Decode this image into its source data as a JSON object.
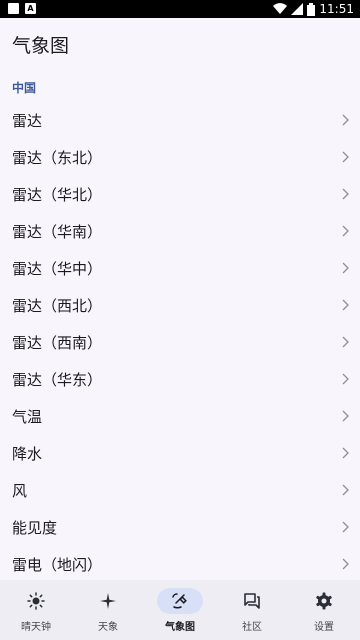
{
  "status": {
    "time": "11:51",
    "icons": [
      "image-icon",
      "a-icon",
      "wifi-icon",
      "signal-icon",
      "battery-icon"
    ],
    "a_letter": "A"
  },
  "header": {
    "title": "气象图"
  },
  "section": {
    "label": "中国"
  },
  "items": [
    {
      "label": "雷达"
    },
    {
      "label": "雷达（东北）"
    },
    {
      "label": "雷达（华北）"
    },
    {
      "label": "雷达（华南）"
    },
    {
      "label": "雷达（华中）"
    },
    {
      "label": "雷达（西北）"
    },
    {
      "label": "雷达（西南）"
    },
    {
      "label": "雷达（华东）"
    },
    {
      "label": "气温"
    },
    {
      "label": "降水"
    },
    {
      "label": "风"
    },
    {
      "label": "能见度"
    },
    {
      "label": "雷电（地闪）"
    }
  ],
  "nav": [
    {
      "label": "晴天钟",
      "icon": "sun-icon",
      "active": false
    },
    {
      "label": "天象",
      "icon": "sparkle-icon",
      "active": false
    },
    {
      "label": "气象图",
      "icon": "satellite-icon",
      "active": true
    },
    {
      "label": "社区",
      "icon": "chat-icon",
      "active": false
    },
    {
      "label": "设置",
      "icon": "gear-icon",
      "active": false
    }
  ],
  "colors": {
    "accent": "#3f5a96",
    "pill": "#d8e0f7",
    "background": "#f8f6fc",
    "nav_bg": "#efedf4"
  }
}
